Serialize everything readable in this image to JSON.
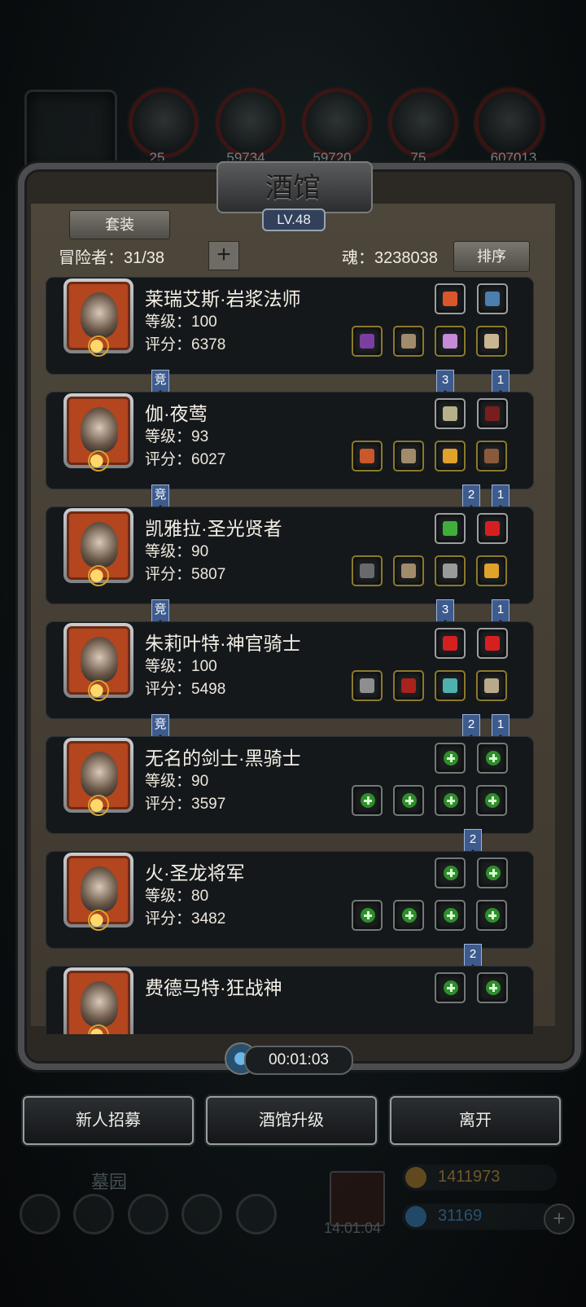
{
  "resources": [
    {
      "name": "leather",
      "value": "25"
    },
    {
      "name": "wood",
      "value": "59734"
    },
    {
      "name": "iron",
      "value": "59720"
    },
    {
      "name": "crystal",
      "value": "75"
    },
    {
      "name": "steel",
      "value": "607013"
    }
  ],
  "panel": {
    "title": "酒馆",
    "level": "LV.48",
    "set_button": "套装",
    "adventurer_label": "冒险者：31/38",
    "add_label": "+",
    "soul_label": "魂：3238038",
    "sort_button": "排序",
    "timer": "00:01:03"
  },
  "heroes": [
    {
      "name": "莱瑞艾斯·岩浆法师",
      "level": "等级：100",
      "score": "评分：6378",
      "arena": "竞",
      "tags": [
        "3",
        "1"
      ],
      "gear_top": [
        "maple-leaf",
        "amulet"
      ],
      "gear_bottom": [
        "staff",
        "armor",
        "tome",
        "mask"
      ],
      "empty": false
    },
    {
      "name": "伽·夜莺",
      "level": "等级：93",
      "score": "评分：6027",
      "arena": "竞",
      "tags": [
        "2",
        "1"
      ],
      "gear_top": [
        "pocket-watch",
        "claw"
      ],
      "gear_bottom": [
        "dagger",
        "armor",
        "ring",
        "gauntlet"
      ],
      "empty": false
    },
    {
      "name": "凯雅拉·圣光贤者",
      "level": "等级：90",
      "score": "评分：5807",
      "arena": "竞",
      "tags": [
        "3",
        "1"
      ],
      "gear_top": [
        "green-gem",
        "red-gem"
      ],
      "gear_bottom": [
        "hammer",
        "armor",
        "helmet",
        "ring"
      ],
      "empty": false
    },
    {
      "name": "朱莉叶特·神官骑士",
      "level": "等级：100",
      "score": "评分：5498",
      "arena": "竞",
      "tags": [
        "2",
        "1"
      ],
      "gear_top": [
        "red-gem",
        "red-gem"
      ],
      "gear_bottom": [
        "axe",
        "robe",
        "bracer",
        "necklace"
      ],
      "empty": false
    },
    {
      "name": "无名的剑士·黑骑士",
      "level": "等级：90",
      "score": "评分：3597",
      "arena": "",
      "tags": [
        "2"
      ],
      "gear_top": [
        "empty",
        "empty"
      ],
      "gear_bottom": [
        "empty",
        "empty",
        "empty",
        "empty"
      ],
      "empty": true
    },
    {
      "name": "火·圣龙将军",
      "level": "等级：80",
      "score": "评分：3482",
      "arena": "",
      "tags": [
        "2"
      ],
      "gear_top": [
        "empty",
        "empty"
      ],
      "gear_bottom": [
        "empty",
        "empty",
        "empty",
        "empty"
      ],
      "empty": true
    },
    {
      "name": "费德马特·狂战神",
      "level": "",
      "score": "",
      "arena": "",
      "tags": [],
      "gear_top": [
        "empty",
        "empty"
      ],
      "gear_bottom": [],
      "empty": true
    }
  ],
  "buttons": {
    "recruit": "新人招募",
    "upgrade": "酒馆升级",
    "leave": "离开"
  },
  "bottom": {
    "graveyard": "墓园",
    "gift_timer": "14:01:04",
    "gold": "1411973",
    "gems": "31169"
  },
  "colors": {
    "frame": "#4b4d4f",
    "card": "#15181b",
    "equip_border": "#8a7a2c",
    "tag": "#3e5b8d",
    "gold": "#e6b04a",
    "gems": "#4aa3e6"
  }
}
